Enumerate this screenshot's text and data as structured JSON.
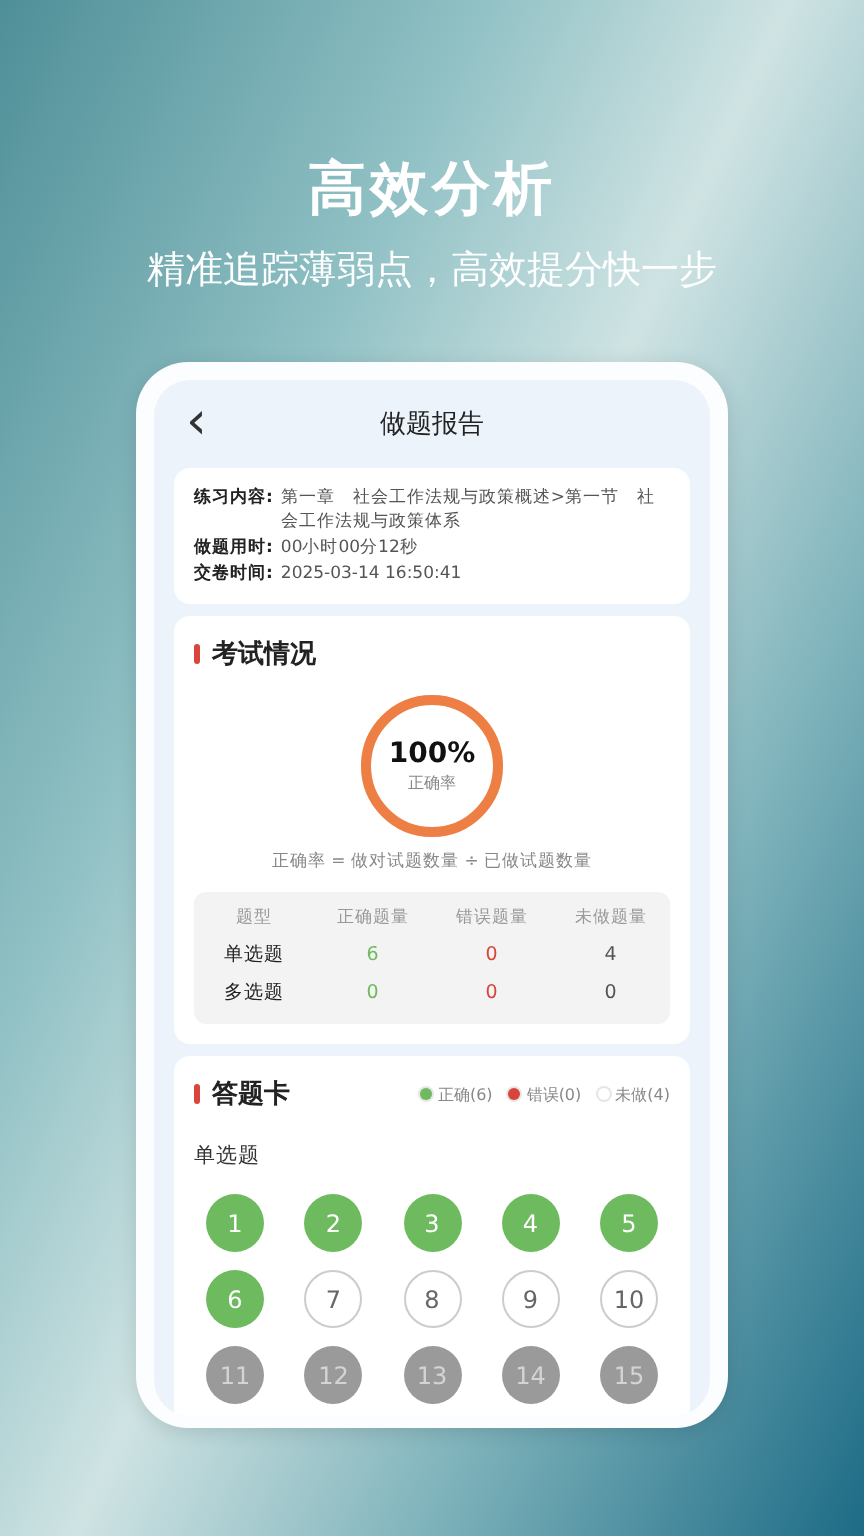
{
  "promo": {
    "headline": "高效分析",
    "tagline": "精准追踪薄弱点，高效提分快一步"
  },
  "nav": {
    "back": "‹",
    "title": "做题报告"
  },
  "info": [
    {
      "label": "练习内容:",
      "value": "第一章　社会工作法规与政策概述>第一节　社会工作法规与政策体系"
    },
    {
      "label": "做题用时:",
      "value": "00小时00分12秒"
    },
    {
      "label": "交卷时间:",
      "value": "2025-03-14 16:50:41"
    }
  ],
  "exam": {
    "title": "考试情况",
    "accuracy": {
      "value": "100%",
      "label": "正确率",
      "level": 1.0
    },
    "formula": "正确率 = 做对试题数量 ÷ 已做试题数量",
    "columns": [
      "题型",
      "正确题量",
      "错误题量",
      "未做题量"
    ],
    "rows": [
      {
        "type": "单选题",
        "correct": "6",
        "wrong": "0",
        "undone": "4"
      },
      {
        "type": "多选题",
        "correct": "0",
        "wrong": "0",
        "undone": "0"
      }
    ]
  },
  "answer_card": {
    "title": "答题卡",
    "legend": [
      {
        "label": "正确(6)",
        "color": "#6dbb5e"
      },
      {
        "label": "错误(0)",
        "color": "#d9453b"
      },
      {
        "label": "未做(4)",
        "color": "#ffffff"
      }
    ],
    "section": "单选题",
    "questions": [
      {
        "number": "1",
        "kind": "correct"
      },
      {
        "number": "2",
        "kind": "correct"
      },
      {
        "number": "3",
        "kind": "correct"
      },
      {
        "number": "4",
        "kind": "correct"
      },
      {
        "number": "5",
        "kind": "correct"
      },
      {
        "number": "6",
        "kind": "correct"
      },
      {
        "number": "7",
        "kind": "undone"
      },
      {
        "number": "8",
        "kind": "undone"
      },
      {
        "number": "9",
        "kind": "undone"
      },
      {
        "number": "10",
        "kind": "undone"
      },
      {
        "number": "11",
        "kind": "grey"
      },
      {
        "number": "12",
        "kind": "grey"
      },
      {
        "number": "13",
        "kind": "grey"
      },
      {
        "number": "14",
        "kind": "grey"
      },
      {
        "number": "15",
        "kind": "grey"
      }
    ]
  }
}
